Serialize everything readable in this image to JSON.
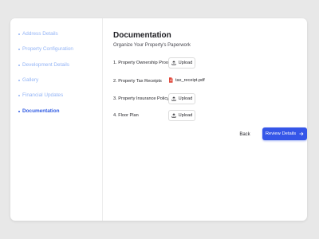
{
  "sidebar": {
    "items": [
      {
        "label": "Address Details",
        "active": false
      },
      {
        "label": "Property Configuration",
        "active": false
      },
      {
        "label": "Development Details",
        "active": false
      },
      {
        "label": "Gallery",
        "active": false
      },
      {
        "label": "Financial Updates",
        "active": false
      },
      {
        "label": "Documentation",
        "active": true
      }
    ]
  },
  "main": {
    "title": "Documentation",
    "subtitle": "Organize Your Property's Paperwork",
    "documents": [
      {
        "label": "1. Property Ownership Proof",
        "action": "Upload"
      },
      {
        "label": "2. Property Tax Receipts",
        "file": "tax_receipt.pdf",
        "file_icon": "pdf-file-icon"
      },
      {
        "label": "3. Property Insurance Policy",
        "action": "Upload"
      },
      {
        "label": "4. Floor Plan",
        "action": "Upload"
      }
    ],
    "back_label": "Back",
    "review_label": "Review Details"
  },
  "colors": {
    "accent": "#3556e8",
    "nav_active": "#2f5be3",
    "nav_inactive": "#93b4f6",
    "pdf": "#e0473a"
  }
}
